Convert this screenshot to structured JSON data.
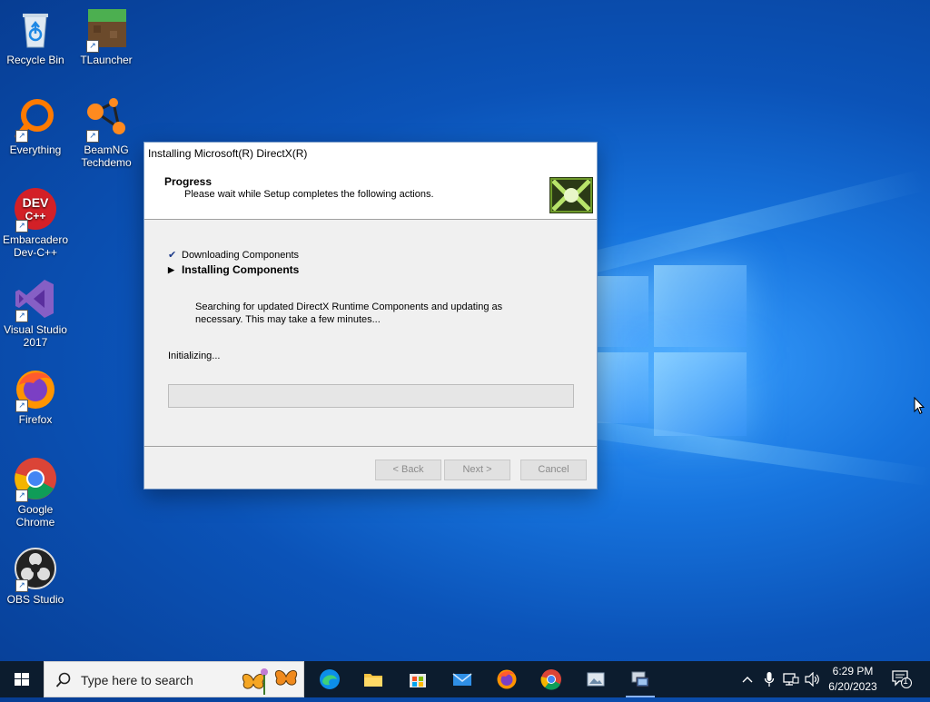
{
  "desktop": {
    "icons": [
      {
        "label": "Recycle Bin",
        "icon": "recycle-bin-icon"
      },
      {
        "label": "TLauncher",
        "icon": "tlauncher-icon"
      },
      {
        "label": "Everything",
        "icon": "everything-icon"
      },
      {
        "label": "BeamNG Techdemo",
        "icon": "beamng-icon"
      },
      {
        "label": "Embarcadero Dev-C++",
        "icon": "devcpp-icon"
      },
      {
        "label": "Visual Studio 2017",
        "icon": "visual-studio-icon"
      },
      {
        "label": "Firefox",
        "icon": "firefox-icon"
      },
      {
        "label": "Google Chrome",
        "icon": "chrome-icon"
      },
      {
        "label": "OBS Studio",
        "icon": "obs-icon"
      }
    ],
    "devcpp_badge_top": "DEV",
    "devcpp_badge_bottom": "C++"
  },
  "dialog": {
    "title": "Installing Microsoft(R) DirectX(R)",
    "header_title": "Progress",
    "header_subtitle": "Please wait while Setup completes the following actions.",
    "steps": [
      {
        "label": "Downloading Components",
        "state": "done",
        "marker": "✔"
      },
      {
        "label": "Installing Components",
        "state": "current",
        "marker": "▶"
      }
    ],
    "description": "Searching for updated DirectX Runtime Components and updating as necessary. This may take a few minutes...",
    "status": "Initializing...",
    "progress_percent": 0,
    "buttons": {
      "back": "< Back",
      "next": "Next >",
      "cancel": "Cancel"
    }
  },
  "taskbar": {
    "search_placeholder": "Type here to search",
    "apps": [
      "edge-icon",
      "file-explorer-icon",
      "store-icon",
      "mail-icon",
      "firefox-icon",
      "chrome-icon",
      "photo-viewer-icon",
      "directx-setup-icon"
    ],
    "active_app": "directx-setup-icon",
    "time": "6:29 PM",
    "date": "6/20/2023",
    "notification_count": "1"
  },
  "colors": {
    "accent": "#0078d7",
    "taskbar": "#0c1c2e",
    "progress_fill": "#06b025"
  }
}
